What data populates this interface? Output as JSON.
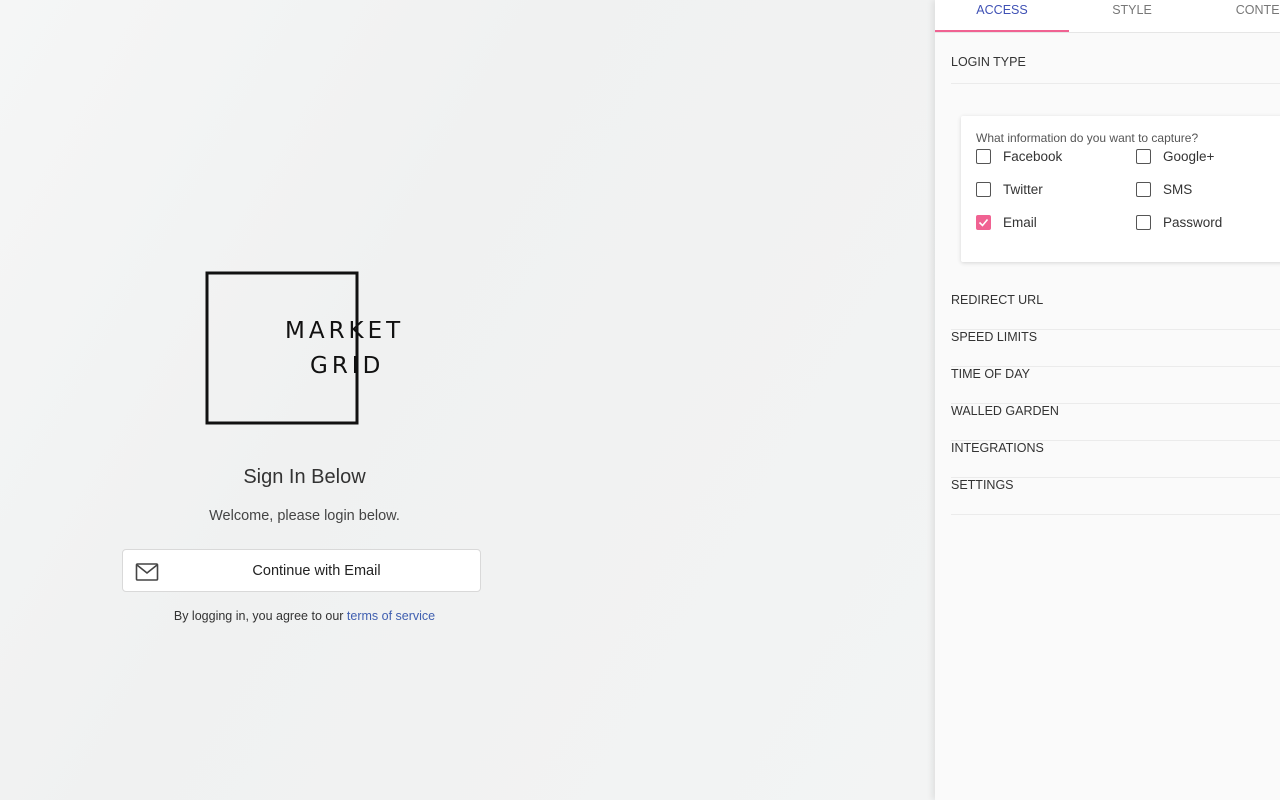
{
  "preview": {
    "logo": {
      "line1": "MARKET",
      "line2": "GRID"
    },
    "title": "Sign In Below",
    "subtitle": "Welcome, please login below.",
    "email_button": "Continue with Email",
    "terms_prefix": "By logging in, you agree to our ",
    "terms_link": "terms of service"
  },
  "panel": {
    "tabs": [
      {
        "label": "ACCESS",
        "active": true
      },
      {
        "label": "STYLE",
        "active": false
      },
      {
        "label": "CONTENT",
        "active": false
      }
    ],
    "login_type_label": "LOGIN TYPE",
    "capture": {
      "question": "What information do you want to capture?",
      "options": [
        {
          "label": "Facebook",
          "checked": false
        },
        {
          "label": "Google+",
          "checked": false
        },
        {
          "label": "Twitter",
          "checked": false
        },
        {
          "label": "SMS",
          "checked": false
        },
        {
          "label": "Email",
          "checked": true
        },
        {
          "label": "Password",
          "checked": false
        }
      ]
    },
    "menu": [
      "REDIRECT URL",
      "SPEED LIMITS",
      "TIME OF DAY",
      "WALLED GARDEN",
      "INTEGRATIONS",
      "SETTINGS"
    ]
  },
  "colors": {
    "accent_pink": "#f06292",
    "tab_active": "#3f51b5",
    "link": "#3f5fb0"
  }
}
